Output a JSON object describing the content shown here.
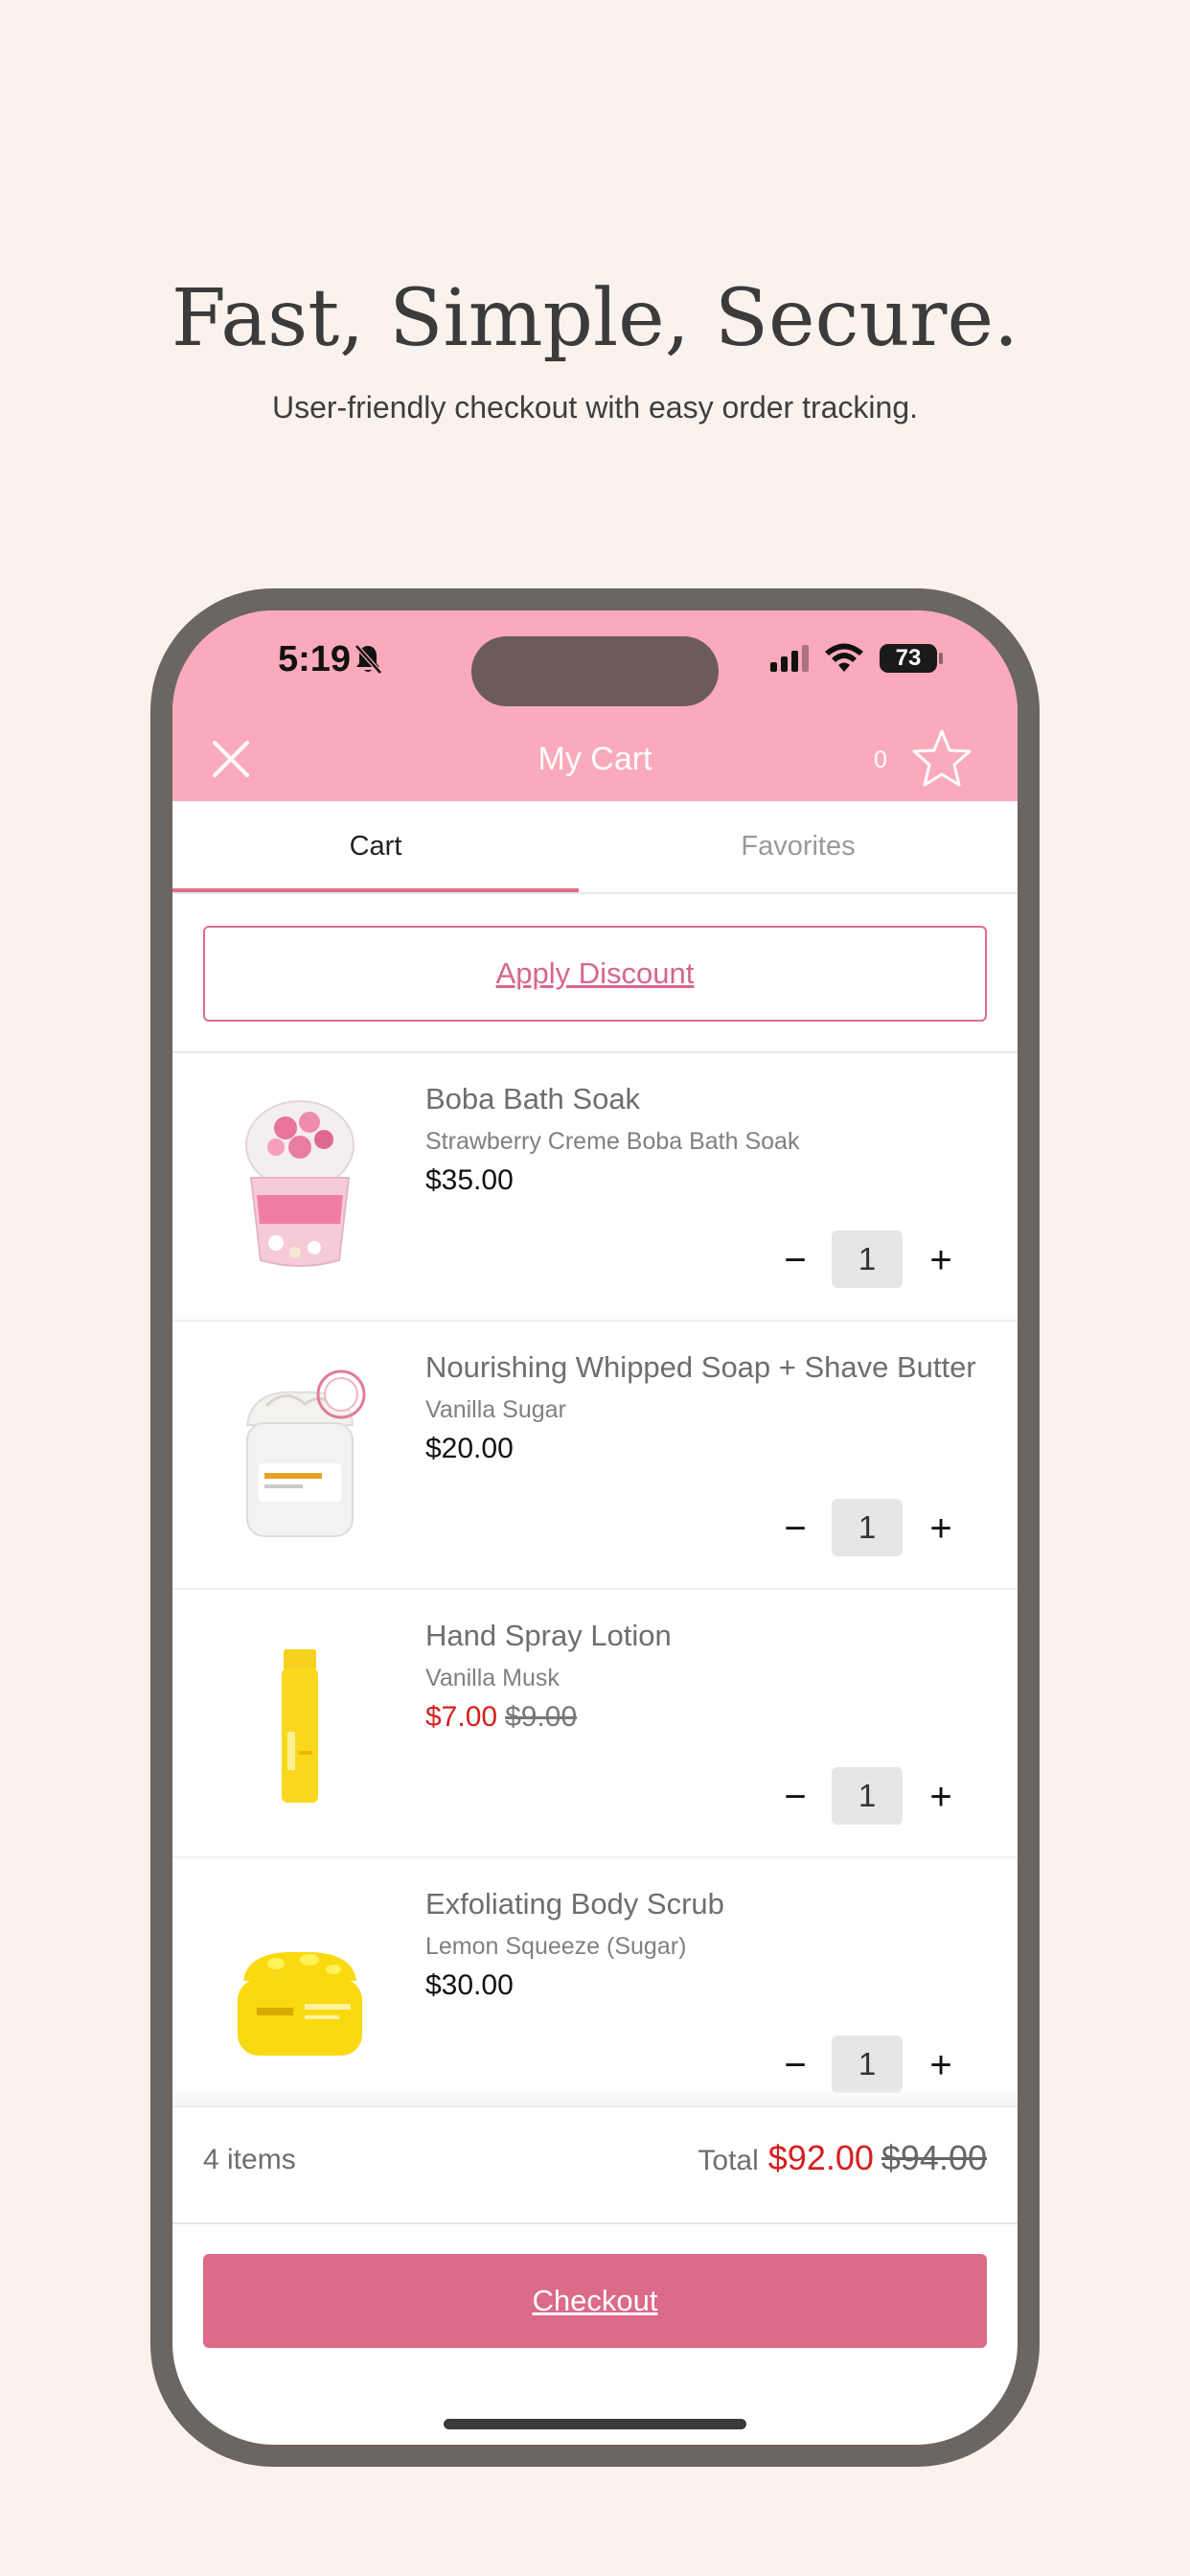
{
  "promo": {
    "headline": "Fast, Simple, Secure.",
    "subline": "User-friendly checkout with easy order tracking."
  },
  "status_bar": {
    "time": "5:19",
    "battery": "73",
    "icons": [
      "bell-slash-icon",
      "cellular-signal-icon",
      "wifi-icon",
      "battery-icon"
    ]
  },
  "header": {
    "title": "My Cart",
    "favorites_count": "0",
    "close_icon": "close-icon",
    "star_icon": "star-outline-icon",
    "background_color": "#fbaabb"
  },
  "tabs": [
    {
      "label": "Cart",
      "active": true
    },
    {
      "label": "Favorites",
      "active": false
    }
  ],
  "discount": {
    "label": "Apply Discount"
  },
  "items": [
    {
      "name": "Boba Bath Soak",
      "variant": "Strawberry Creme Boba Bath Soak",
      "price": "$35.00",
      "sale_price": "",
      "original_price": "",
      "quantity": "1"
    },
    {
      "name": "Nourishing Whipped Soap + Shave Butter",
      "variant": "Vanilla Sugar",
      "price": "$20.00",
      "sale_price": "",
      "original_price": "",
      "quantity": "1"
    },
    {
      "name": "Hand Spray Lotion",
      "variant": "Vanilla Musk",
      "price": "",
      "sale_price": "$7.00",
      "original_price": "$9.00",
      "quantity": "1"
    },
    {
      "name": "Exfoliating Body Scrub",
      "variant": "Lemon Squeeze (Sugar)",
      "price": "$30.00",
      "sale_price": "",
      "original_price": "",
      "quantity": "1"
    }
  ],
  "stepper": {
    "minus": "−",
    "plus": "+"
  },
  "summary": {
    "items_count": "4 items",
    "total_label": "Total",
    "total": "$92.00",
    "original_total": "$94.00"
  },
  "checkout": {
    "label": "Checkout",
    "color": "#dc6a89"
  },
  "colors": {
    "accent": "#dc6e8c",
    "sale": "#d71f1f",
    "page_bg": "#faf2ed"
  }
}
